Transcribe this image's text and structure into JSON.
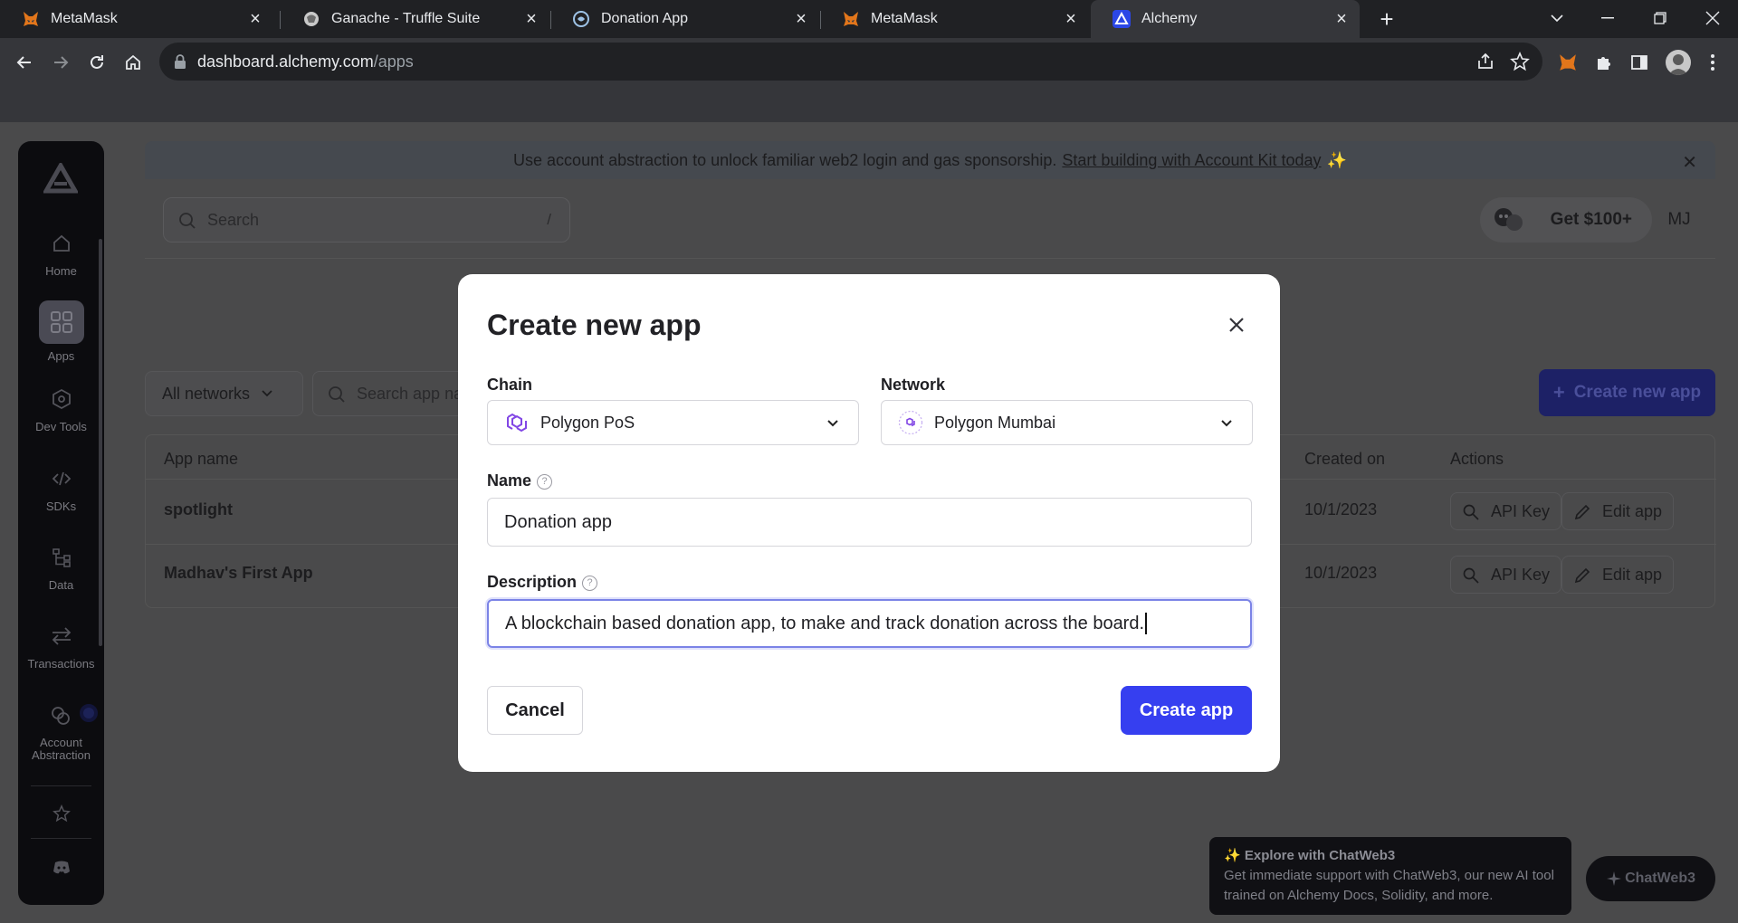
{
  "browser": {
    "tabs": [
      {
        "title": "MetaMask",
        "icon": "metamask-fox-icon"
      },
      {
        "title": "Ganache - Truffle Suite",
        "icon": "ganache-icon"
      },
      {
        "title": "Donation App",
        "icon": "donation-app-icon"
      },
      {
        "title": "MetaMask",
        "icon": "metamask-fox-icon"
      },
      {
        "title": "Alchemy",
        "icon": "alchemy-icon",
        "active": true
      }
    ],
    "url_host": "dashboard.alchemy.com",
    "url_path": "/apps"
  },
  "banner": {
    "text": "Use account abstraction to unlock familiar web2 login and gas sponsorship.",
    "link": "Start building with Account Kit today",
    "sparkle": "✨"
  },
  "sidebar": {
    "items": [
      {
        "label": "Home",
        "icon": "home-icon"
      },
      {
        "label": "Apps",
        "icon": "apps-grid-icon",
        "active": true
      },
      {
        "label": "Dev Tools",
        "icon": "dev-tools-icon"
      },
      {
        "label": "SDKs",
        "icon": "code-icon"
      },
      {
        "label": "Data",
        "icon": "data-tree-icon"
      },
      {
        "label": "Transactions",
        "icon": "transactions-arrows-icon"
      },
      {
        "label": "Account Abstraction",
        "icon": "account-abstraction-icon"
      }
    ]
  },
  "topbar": {
    "search_placeholder": "Search",
    "search_shortcut": "/",
    "reward_label": "Get $100+",
    "user_initials": "MJ"
  },
  "apps_page": {
    "network_filter": "All networks",
    "search_placeholder": "Search app na",
    "create_button": "Create new app",
    "columns": {
      "app_name": "App name",
      "created_on": "Created on",
      "actions": "Actions"
    },
    "rows": [
      {
        "name": "spotlight",
        "created": "10/1/2023",
        "api_key": "API Key",
        "edit": "Edit app"
      },
      {
        "name": "Madhav's First App",
        "created": "10/1/2023",
        "api_key": "API Key",
        "edit": "Edit app"
      }
    ]
  },
  "chat": {
    "popup_title": "✨ Explore with ChatWeb3",
    "popup_text": "Get immediate support with ChatWeb3, our new AI tool trained on Alchemy Docs, Solidity, and more.",
    "button": "ChatWeb3"
  },
  "modal": {
    "title": "Create new app",
    "chain_label": "Chain",
    "chain_value": "Polygon PoS",
    "network_label": "Network",
    "network_value": "Polygon Mumbai",
    "name_label": "Name",
    "name_value": "Donation app",
    "description_label": "Description",
    "description_value": "A blockchain based donation app, to make and track donation across the board.",
    "cancel": "Cancel",
    "submit": "Create app",
    "accent_color": "#363ff0"
  }
}
